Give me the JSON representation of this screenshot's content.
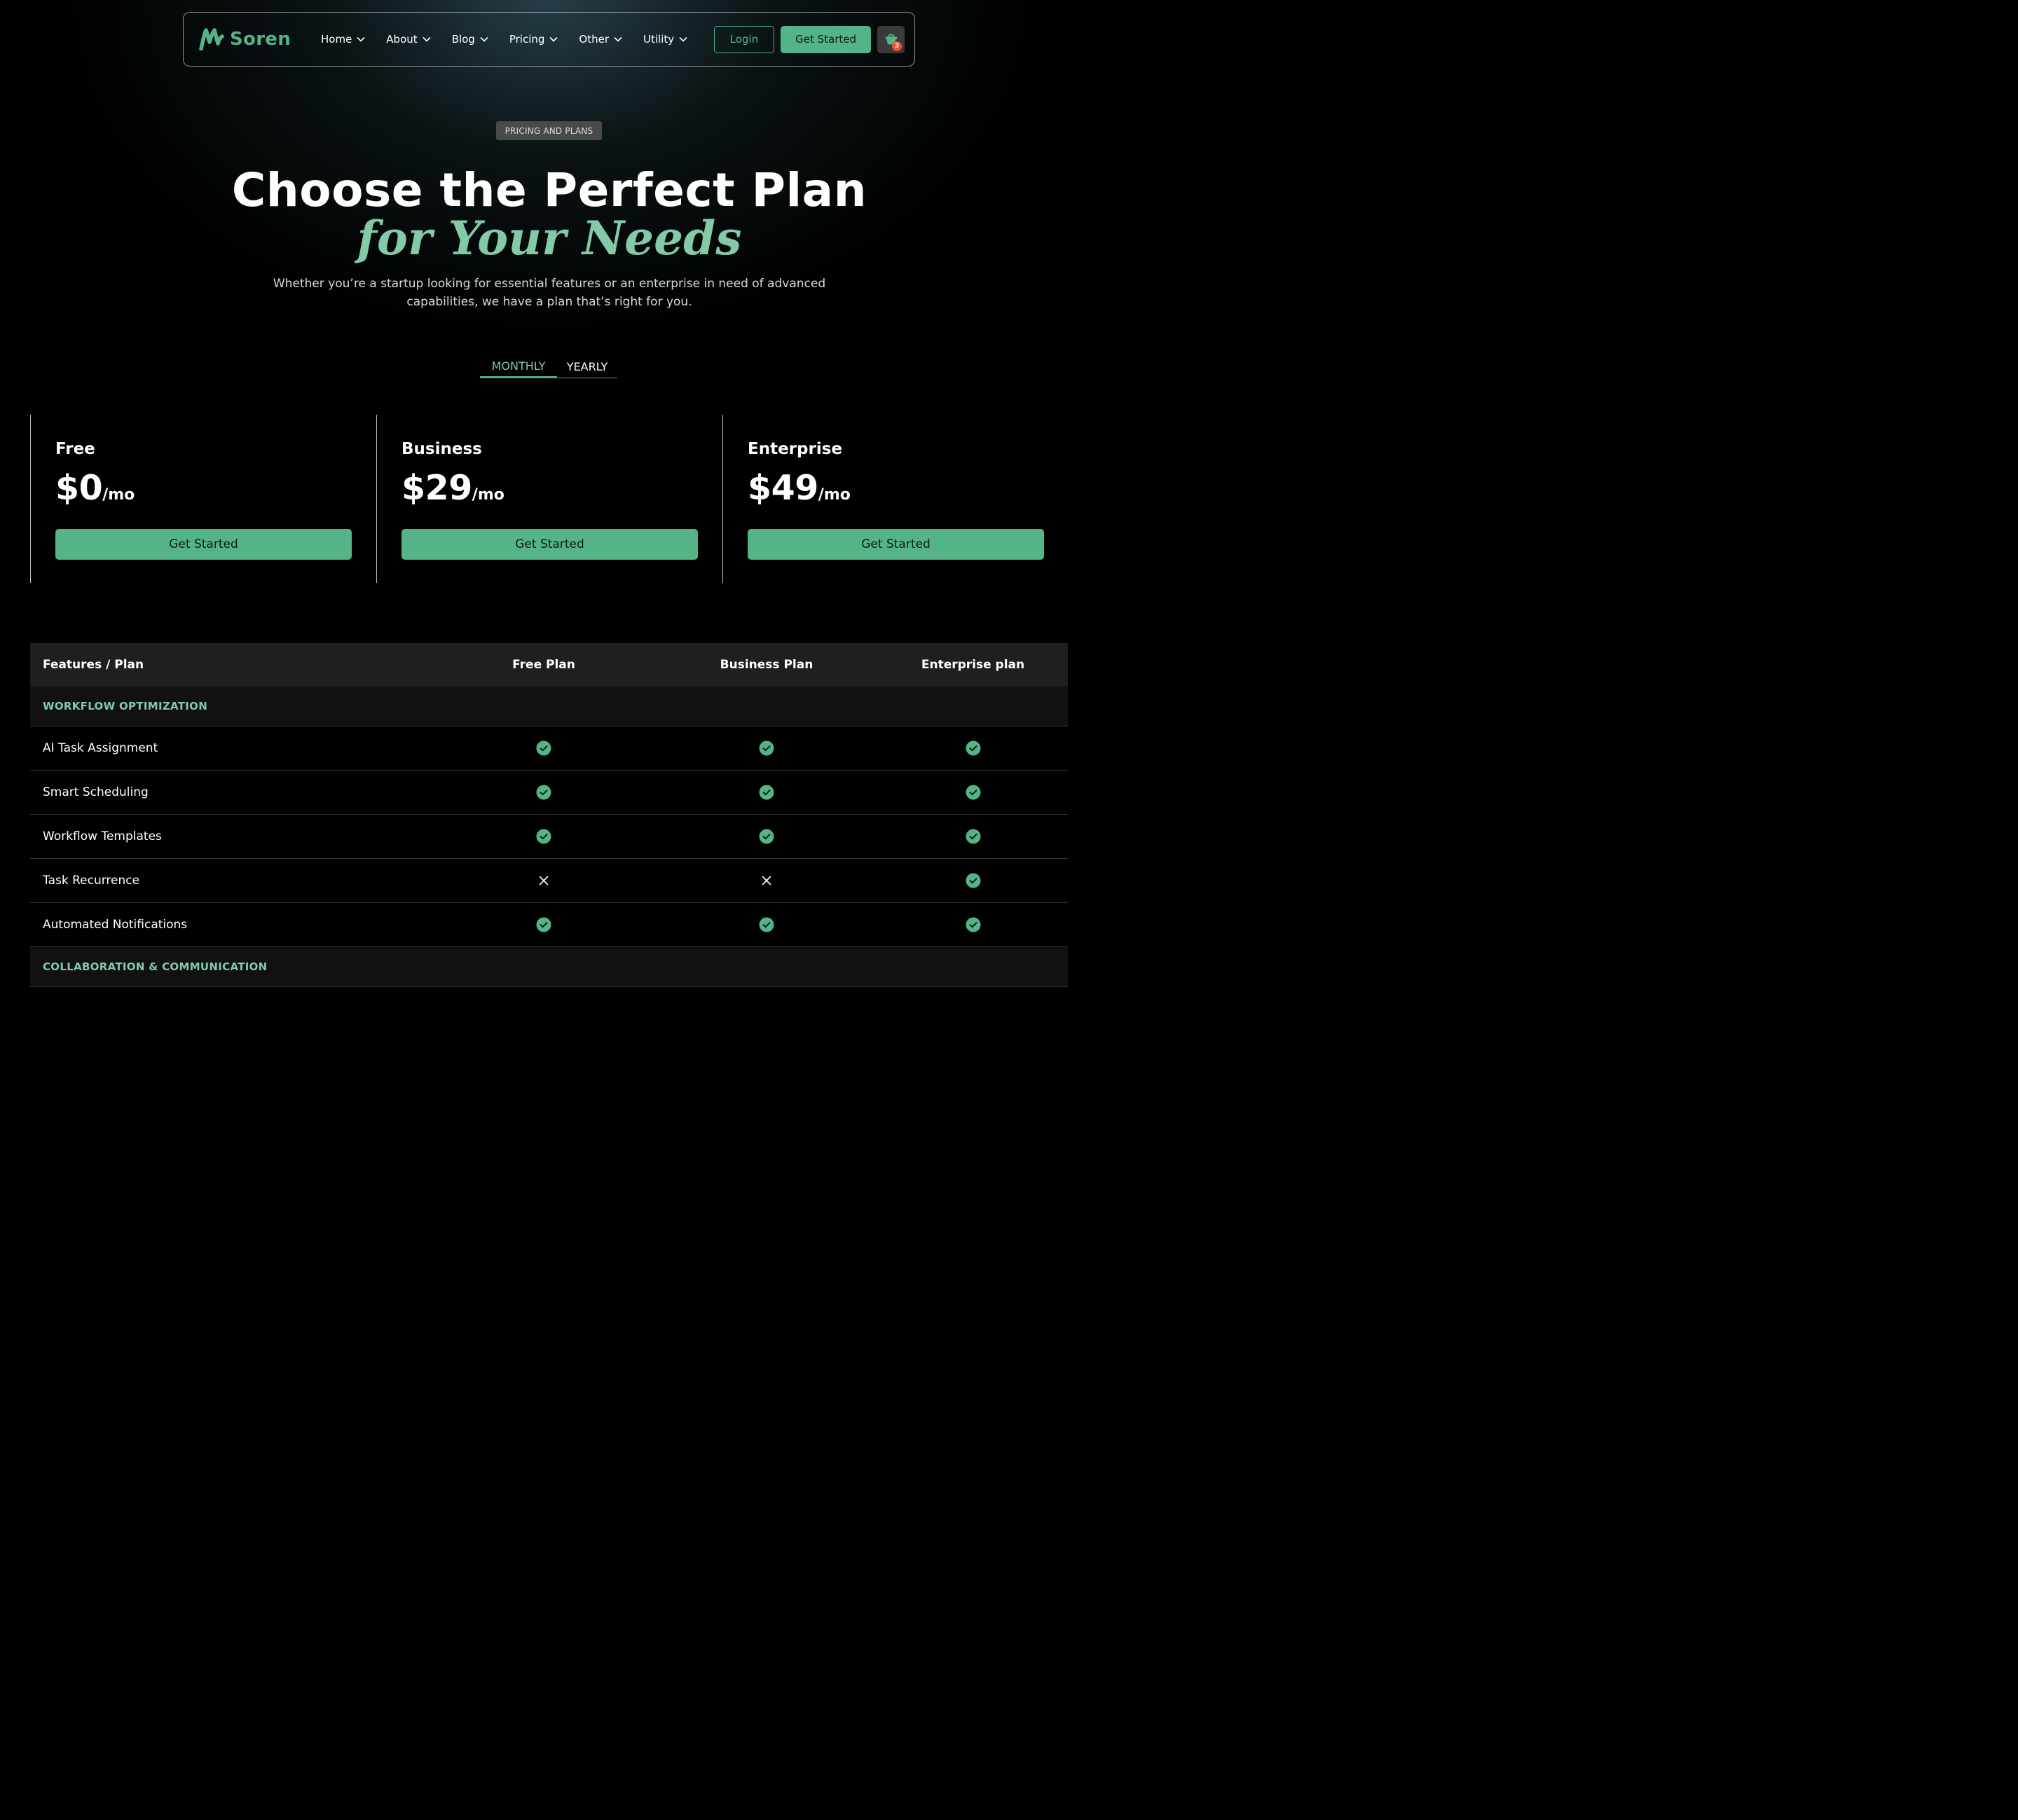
{
  "nav": {
    "logo_text": "Soren",
    "menu": [
      {
        "label": "Home"
      },
      {
        "label": "About"
      },
      {
        "label": "Blog"
      },
      {
        "label": "Pricing"
      },
      {
        "label": "Other"
      },
      {
        "label": "Utility"
      }
    ],
    "login_label": "Login",
    "cta_label": "Get Started",
    "cart_count": "3"
  },
  "hero": {
    "eyebrow": "PRICING AND PLANS",
    "title": "Choose the Perfect Plan",
    "title_accent": "for Your Needs",
    "description": "Whether you’re a startup looking for essential features or an enterprise in need of advanced capabilities, we have a plan that’s right for you."
  },
  "billing_toggle": {
    "monthly": "MONTHLY",
    "yearly": "YEARLY",
    "selected": "MONTHLY"
  },
  "plans": [
    {
      "name": "Free",
      "price": "$0",
      "period": "/mo",
      "button": "Get Started"
    },
    {
      "name": "Business",
      "price": "$29",
      "period": "/mo",
      "button": "Get Started"
    },
    {
      "name": "Enterprise",
      "price": "$49",
      "period": "/mo",
      "button": "Get Started"
    }
  ],
  "comparison": {
    "headers": [
      "Features / Plan",
      "Free Plan",
      "Business Plan",
      "Enterprise plan"
    ],
    "sections": [
      {
        "title": "WORKFLOW OPTIMIZATION",
        "rows": [
          {
            "feature": "AI Task Assignment",
            "free": true,
            "business": true,
            "enterprise": true
          },
          {
            "feature": "Smart Scheduling",
            "free": true,
            "business": true,
            "enterprise": true
          },
          {
            "feature": "Workflow Templates",
            "free": true,
            "business": true,
            "enterprise": true
          },
          {
            "feature": "Task Recurrence",
            "free": false,
            "business": false,
            "enterprise": true
          },
          {
            "feature": "Automated Notifications",
            "free": true,
            "business": true,
            "enterprise": true
          }
        ]
      },
      {
        "title": "COLLABORATION & COMMUNICATION",
        "rows": []
      }
    ]
  },
  "colors": {
    "accent": "#55b487",
    "accent_light": "#84c9a8",
    "background": "#000000",
    "badge": "#e8553a"
  }
}
